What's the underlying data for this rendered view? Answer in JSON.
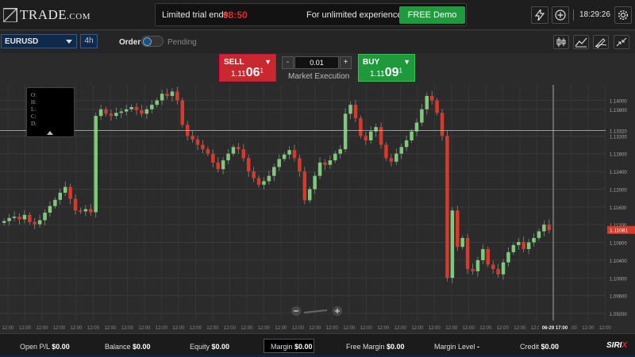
{
  "header": {
    "logo_text": "TRADE",
    "logo_suffix": ".COM",
    "trial_label": "Limited trial ends:",
    "trial_timer": "08:50",
    "trial_experience": "For unlimited experience",
    "demo_button": "FREE Demo",
    "clock": "18:29:26",
    "icons": [
      "lightning-icon",
      "plus-circle-icon",
      "gear-icon"
    ]
  },
  "toolbar": {
    "symbol": "EURUSD",
    "timeframe": "4h",
    "order_label": "Order",
    "pending_label": "Pending",
    "tools": [
      "candlestick-icon",
      "line-chart-icon",
      "draw-icon",
      "collapse-icon"
    ]
  },
  "trade": {
    "sell_label": "SELL",
    "sell_price_prefix": "1.11",
    "sell_price_big": "06",
    "sell_price_sup": "1",
    "buy_label": "BUY",
    "buy_price_prefix": "1.11",
    "buy_price_big": "09",
    "buy_price_sup": "1",
    "quantity": "0.01",
    "minus": "-",
    "plus": "+",
    "execution": "Market Execution"
  },
  "ohlc": {
    "o": "O:",
    "h": "H:",
    "l": "L:",
    "c": "C:",
    "d": "D:"
  },
  "chart_data": {
    "type": "candlestick",
    "symbol": "EURUSD",
    "timeframe": "4h",
    "y_ticks": [
      "1.14000",
      "1.13800",
      "1.13320",
      "1.13200",
      "1.12800",
      "1.12400",
      "1.12000",
      "1.11600",
      "1.11200",
      "1.10800",
      "1.10400",
      "1.10000",
      "1.09600",
      "1.09200"
    ],
    "y_tick_values": [
      1.14,
      1.138,
      1.1332,
      1.132,
      1.128,
      1.124,
      1.12,
      1.116,
      1.112,
      1.108,
      1.104,
      1.1,
      1.096,
      1.092
    ],
    "ylim": [
      1.0904,
      1.1435
    ],
    "crosshair_price": "1.13320",
    "crosshair_value": 1.1332,
    "current_price": "1.11081",
    "current_value": 1.11081,
    "x_labels": [
      "12:00",
      "12:00",
      "12:00",
      "12:00",
      "12:00",
      "12:00",
      "12:00",
      "12:00",
      "12:00",
      "12:00",
      "12:00",
      "12:00",
      "12:00",
      "12:00",
      "12:00",
      "12:00",
      "12:00",
      "12:00",
      "12:00",
      "12:00",
      "12:00",
      "12:00",
      "12:00",
      "12:00",
      "12:00",
      "12:00",
      "12:00",
      "12:00",
      "12:00",
      "12:00",
      "12:00",
      "12:00",
      "12:00",
      "12:00",
      "12:00",
      "12:00"
    ],
    "crosshair_time": "06-29 17:00",
    "up_color": "#7fc97a",
    "down_color": "#d8392b",
    "closes": [
      1.1128,
      1.1135,
      1.1138,
      1.1132,
      1.1142,
      1.1126,
      1.1121,
      1.113,
      1.1147,
      1.1162,
      1.1176,
      1.1192,
      1.1205,
      1.1178,
      1.1152,
      1.115,
      1.1155,
      1.1148,
      1.1365,
      1.138,
      1.137,
      1.1365,
      1.1372,
      1.1375,
      1.138,
      1.1385,
      1.1378,
      1.137,
      1.138,
      1.139,
      1.14,
      1.1415,
      1.141,
      1.142,
      1.14,
      1.1345,
      1.132,
      1.1312,
      1.13,
      1.129,
      1.128,
      1.126,
      1.1245,
      1.1265,
      1.128,
      1.1295,
      1.129,
      1.127,
      1.124,
      1.1225,
      1.121,
      1.1218,
      1.123,
      1.125,
      1.1268,
      1.1278,
      1.1288,
      1.127,
      1.124,
      1.1175,
      1.12,
      1.123,
      1.126,
      1.1255,
      1.1265,
      1.128,
      1.129,
      1.137,
      1.139,
      1.136,
      1.132,
      1.131,
      1.133,
      1.134,
      1.13,
      1.127,
      1.1262,
      1.128,
      1.1295,
      1.131,
      1.133,
      1.135,
      1.138,
      1.141,
      1.14,
      1.1372,
      1.132,
      1.1,
      1.1152,
      1.107,
      1.109,
      1.102,
      1.1015,
      1.104,
      1.1065,
      1.103,
      1.102,
      1.1008,
      1.1035,
      1.1058,
      1.1074,
      1.1081,
      1.1065,
      1.108,
      1.109,
      1.1105,
      1.112,
      1.1108
    ]
  },
  "zoom": {
    "minus": "−",
    "plus": "+"
  },
  "footer": {
    "open_pl": "Open P/L ",
    "open_pl_value": "$0.00",
    "balance": "Balance ",
    "balance_value": "$0.00",
    "equity": "Equity ",
    "equity_value": "$0.00",
    "margin": "Margin ",
    "margin_value": "$0.00",
    "free_margin": "Free Margin ",
    "free_margin_value": "$0.00",
    "margin_level": "Margin Level ",
    "margin_level_value": "-",
    "credit": "Credit ",
    "credit_value": "$0.00",
    "brand": "SIRI",
    "brand_suffix": "X"
  }
}
